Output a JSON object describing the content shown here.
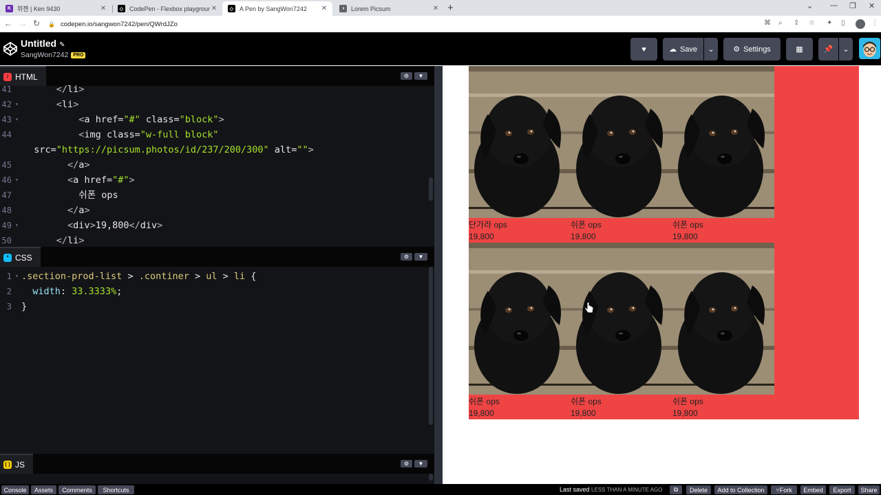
{
  "browser": {
    "tabs": [
      {
        "label": "위젠 | Ken 9430",
        "favicon": "K",
        "color": "#6b2fb3"
      },
      {
        "label": "CodePen - Flexbox playground",
        "favicon": "C",
        "color": "#000000"
      },
      {
        "label": "A Pen by SangWon7242",
        "favicon": "C",
        "color": "#000000"
      },
      {
        "label": "Lorem Picsum",
        "favicon": "L",
        "color": "#5f6368"
      }
    ],
    "url": "codepen.io/sangwon7242/pen/QWrdJZo"
  },
  "header": {
    "title": "Untitled",
    "user": "SangWon7242",
    "badge": "PRO",
    "save_label": "Save",
    "settings_label": "Settings"
  },
  "editors": {
    "html": {
      "label": "HTML",
      "lines": [
        {
          "n": "41",
          "fold": false,
          "html": "      <span class=\"t-tag\">&lt;/</span><span class=\"t-name\">li</span><span class=\"t-tag\">&gt;</span>"
        },
        {
          "n": "42",
          "fold": true,
          "html": "      <span class=\"t-tag\">&lt;</span><span class=\"t-name\">li</span><span class=\"t-tag\">&gt;</span>"
        },
        {
          "n": "43",
          "fold": true,
          "html": "          <span class=\"t-tag\">&lt;</span><span class=\"t-name\">a</span> <span class=\"t-attr\">href</span>=<span class=\"t-str\">\"#\"</span> <span class=\"t-attr\">class</span>=<span class=\"t-str\">\"block\"</span><span class=\"t-tag\">&gt;</span>"
        },
        {
          "n": "44",
          "fold": false,
          "html": "          <span class=\"t-tag\">&lt;</span><span class=\"t-name\">img</span> <span class=\"t-attr\">class</span>=<span class=\"t-str\">\"w-full block\"</span>"
        },
        {
          "n": "",
          "fold": false,
          "html": "  <span class=\"t-attr\">src</span>=<span class=\"t-str\">\"https://picsum.photos/id/237/200/300\"</span> <span class=\"t-attr\">alt</span>=<span class=\"t-str\">\"\"</span><span class=\"t-tag\">&gt;</span>"
        },
        {
          "n": "45",
          "fold": false,
          "html": "        <span class=\"t-tag\">&lt;/</span><span class=\"t-name\">a</span><span class=\"t-tag\">&gt;</span>"
        },
        {
          "n": "46",
          "fold": true,
          "html": "        <span class=\"t-tag\">&lt;</span><span class=\"t-name\">a</span> <span class=\"t-attr\">href</span>=<span class=\"t-str\">\"#\"</span><span class=\"t-tag\">&gt;</span>"
        },
        {
          "n": "47",
          "fold": false,
          "html": "          쉬폰 ops"
        },
        {
          "n": "48",
          "fold": false,
          "html": "        <span class=\"t-tag\">&lt;/</span><span class=\"t-name\">a</span><span class=\"t-tag\">&gt;</span>"
        },
        {
          "n": "49",
          "fold": true,
          "html": "        <span class=\"t-tag\">&lt;</span><span class=\"t-name\">div</span><span class=\"t-tag\">&gt;</span>19,800<span class=\"t-tag\">&lt;/</span><span class=\"t-name\">div</span><span class=\"t-tag\">&gt;</span>"
        },
        {
          "n": "50",
          "fold": false,
          "html": "      <span class=\"t-tag\">&lt;/</span><span class=\"t-name\">li</span><span class=\"t-tag\">&gt;</span>"
        }
      ]
    },
    "css": {
      "label": "CSS",
      "lines": [
        {
          "n": "1",
          "fold": true,
          "html": "<span class=\"t-sel\">.section-prod-list</span> &gt; <span class=\"t-sel\">.continer</span> &gt; <span class=\"t-sel\">ul</span> &gt; <span class=\"t-sel\">li</span> {"
        },
        {
          "n": "2",
          "fold": false,
          "html": "  <span class=\"t-prop\">width</span>: <span class=\"t-val\">33.3333%</span>;"
        },
        {
          "n": "3",
          "fold": false,
          "html": "}"
        }
      ]
    },
    "js": {
      "label": "JS"
    }
  },
  "preview": {
    "products": [
      {
        "name": "단가라 ops",
        "price": "19,800"
      },
      {
        "name": "쉬폰 ops",
        "price": "19,800"
      },
      {
        "name": "쉬폰 ops",
        "price": "19,800"
      },
      {
        "name": "쉬폰 ops",
        "price": "19,800"
      },
      {
        "name": "쉬폰 ops",
        "price": "19,800"
      },
      {
        "name": "쉬폰 ops",
        "price": "19,800"
      }
    ],
    "accent": "#ef4444"
  },
  "footer": {
    "left": [
      "Console",
      "Assets",
      "Comments",
      "Shortcuts"
    ],
    "saved_prefix": "Last saved",
    "saved_time": "LESS THAN A MINUTE AGO",
    "right": [
      "Delete",
      "Add to Collection",
      "Fork",
      "Embed",
      "Export",
      "Share"
    ]
  }
}
